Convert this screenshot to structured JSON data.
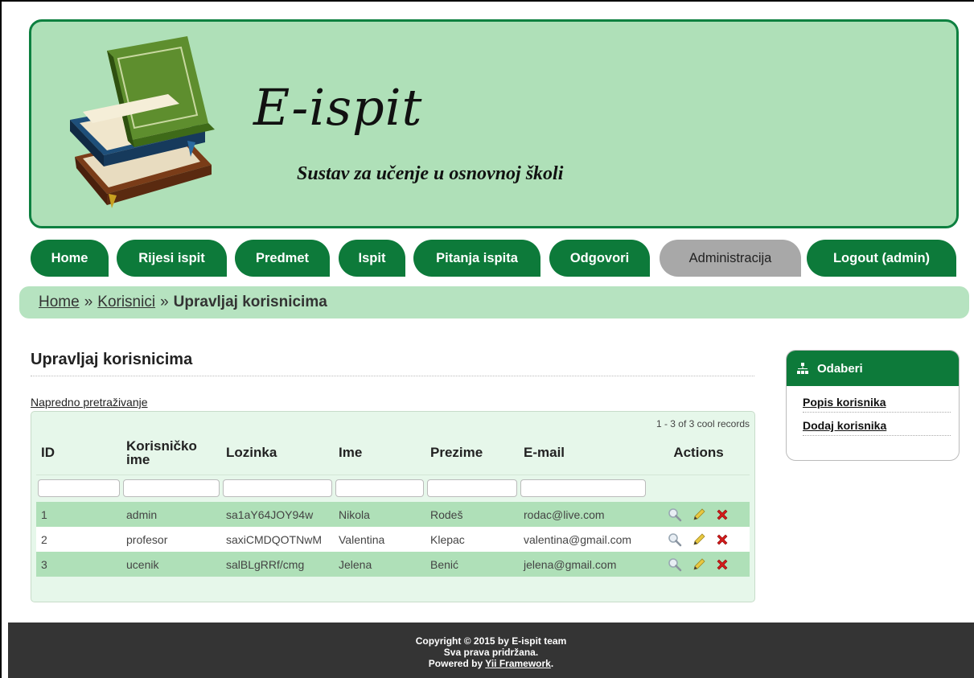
{
  "header": {
    "title": "E-ispit",
    "subtitle": "Sustav za učenje u osnovnoj školi"
  },
  "nav": {
    "items": [
      {
        "label": "Home"
      },
      {
        "label": "Rijesi ispit"
      },
      {
        "label": "Predmet"
      },
      {
        "label": "Ispit"
      },
      {
        "label": "Pitanja ispita"
      },
      {
        "label": "Odgovori"
      },
      {
        "label": "Administracija"
      },
      {
        "label": "Logout (admin)"
      }
    ],
    "active": "Administracija"
  },
  "breadcrumb": {
    "home": "Home",
    "sep": "»",
    "parent": "Korisnici",
    "current": "Upravljaj korisnicima"
  },
  "main": {
    "title": "Upravljaj korisnicima",
    "advanced_search": "Napredno pretraživanje",
    "summary": "1 - 3 of 3 cool records",
    "columns": [
      "ID",
      "Korisničko ime",
      "Lozinka",
      "Ime",
      "Prezime",
      "E-mail",
      "Actions"
    ],
    "rows": [
      {
        "id": "1",
        "username": "admin",
        "password": "sa1aY64JOY94w",
        "first": "Nikola",
        "last": "Rodeš",
        "email": "rodac@live.com"
      },
      {
        "id": "2",
        "username": "profesor",
        "password": "saxiCMDQOTNwM",
        "first": "Valentina",
        "last": "Klepac",
        "email": "valentina@gmail.com"
      },
      {
        "id": "3",
        "username": "ucenik",
        "password": "salBLgRRf/cmg",
        "first": "Jelena",
        "last": "Benić",
        "email": "jelena@gmail.com"
      }
    ]
  },
  "sidebar": {
    "title": "Odaberi",
    "items": [
      {
        "label": "Popis korisnika"
      },
      {
        "label": "Dodaj korisnika"
      }
    ]
  },
  "footer": {
    "line1": "Copyright © 2015 by E-ispit team",
    "line2": "Sva prava pridržana.",
    "line3_prefix": "Powered by ",
    "line3_link": "Yii Framework",
    "line3_suffix": "."
  },
  "colors": {
    "primary_green": "#0d7a3a",
    "light_green": "#afe0b8",
    "active_tab_gray": "#a8a8a8",
    "footer_bg": "#343434"
  }
}
